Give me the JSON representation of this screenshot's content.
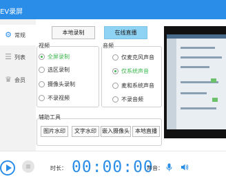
{
  "window": {
    "title": "EV录屏"
  },
  "sidebar": {
    "items": [
      {
        "label": "常规",
        "icon": "gear-icon"
      },
      {
        "label": "列表",
        "icon": "list-icon"
      },
      {
        "label": "会员",
        "icon": "crown-icon"
      }
    ]
  },
  "mode_tabs": {
    "local": "本地录制",
    "live": "在线直播"
  },
  "video": {
    "title": "视频",
    "options": [
      "全屏录制",
      "选区录制",
      "摄像头录制",
      "不录视频"
    ],
    "selected": "全屏录制"
  },
  "audio": {
    "title": "音频",
    "options": [
      "仅麦克风声音",
      "仅系统声音",
      "麦和系统声音",
      "不录音频"
    ],
    "selected": "仅系统声音"
  },
  "tools": {
    "title": "辅助工具",
    "buttons": [
      "图片水印",
      "文字水印",
      "嵌入摄像头",
      "本地直播"
    ]
  },
  "bottom": {
    "duration_label": "时长：",
    "timer": "00:00:00",
    "volume_label": "声音："
  },
  "colors": {
    "accent": "#2a8de8",
    "selected": "#3ab64b",
    "live_tab": "#8fd3f4"
  }
}
